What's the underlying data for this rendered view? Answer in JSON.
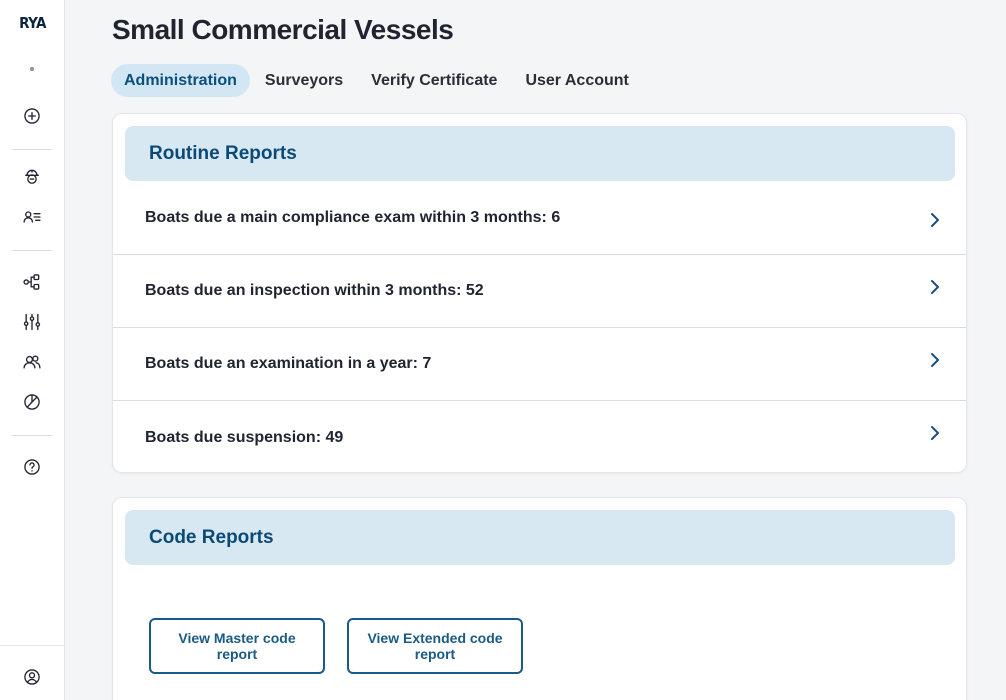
{
  "sidebar": {
    "logo": "RYA",
    "icons": [
      "add-circle-icon",
      "inspector-badge-icon",
      "user-list-icon",
      "workflow-icon",
      "sliders-icon",
      "users-icon",
      "pie-chart-icon",
      "help-icon",
      "account-circle-icon"
    ]
  },
  "page": {
    "title": "Small Commercial Vessels"
  },
  "tabs": [
    {
      "label": "Administration",
      "active": true
    },
    {
      "label": "Surveyors",
      "active": false
    },
    {
      "label": "Verify Certificate",
      "active": false
    },
    {
      "label": "User Account",
      "active": false
    }
  ],
  "routine": {
    "title": "Routine Reports",
    "rows": [
      {
        "label": "Boats due a main compliance exam within 3 months: 6"
      },
      {
        "label": "Boats due an inspection within 3 months: 52"
      },
      {
        "label": "Boats due an examination in a year: 7"
      },
      {
        "label": "Boats due suspension: 49"
      }
    ]
  },
  "code": {
    "title": "Code Reports",
    "buttons": [
      {
        "label": "View Master code report"
      },
      {
        "label": "View Extended code report"
      }
    ]
  },
  "colors": {
    "accent": "#1a5a84",
    "header_bg": "#d8e8f3",
    "active_tab_bg": "#d3e6f3"
  }
}
